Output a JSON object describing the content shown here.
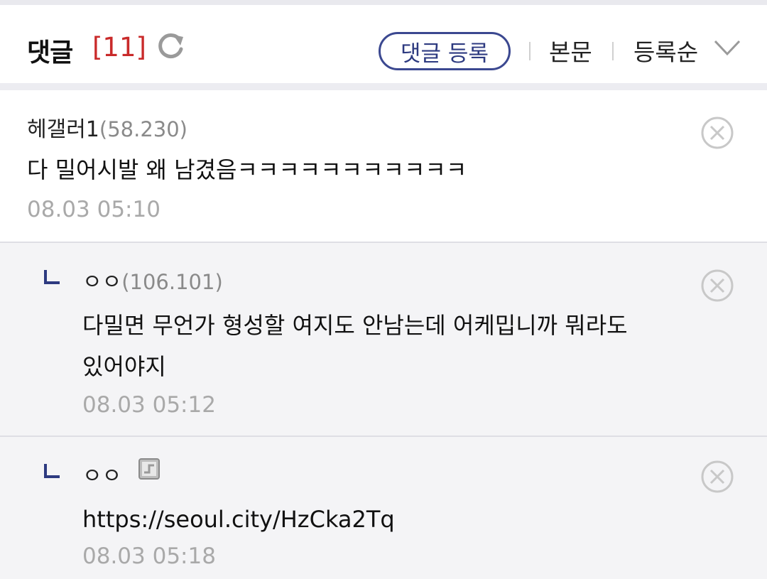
{
  "header": {
    "title": "댓글",
    "count": "[11]",
    "write_button": "댓글 등록",
    "body_link": "본문",
    "sort_label": "등록순"
  },
  "comments": [
    {
      "nick": "헤갤러1",
      "ip": "(58.230)",
      "text_lines": [
        "다 밀어시발 왜 남겼음ㅋㅋㅋㅋㅋㅋㅋㅋㅋㅋㅋ"
      ],
      "date": "08.03 05:10"
    },
    {
      "nick": "ㅇㅇ",
      "ip": "(106.101)",
      "text_lines": [
        "다밀면 무언가 형성할 여지도 안남는데 어케밉니까 뭐라도",
        "있어야지"
      ],
      "date": "08.03 05:12"
    },
    {
      "nick": "ㅇㅇ",
      "ip": "",
      "text_lines": [
        "https://seoul.city/HzCka2Tq"
      ],
      "date": "08.03 05:18"
    }
  ],
  "colors": {
    "accent": "#3b4890",
    "count": "#c92a2a",
    "reply_bg": "#f4f4f6"
  },
  "icons": [
    "refresh-icon",
    "chevron-down-icon",
    "delete-icon",
    "reply-arrow-icon",
    "gallog-icon"
  ]
}
